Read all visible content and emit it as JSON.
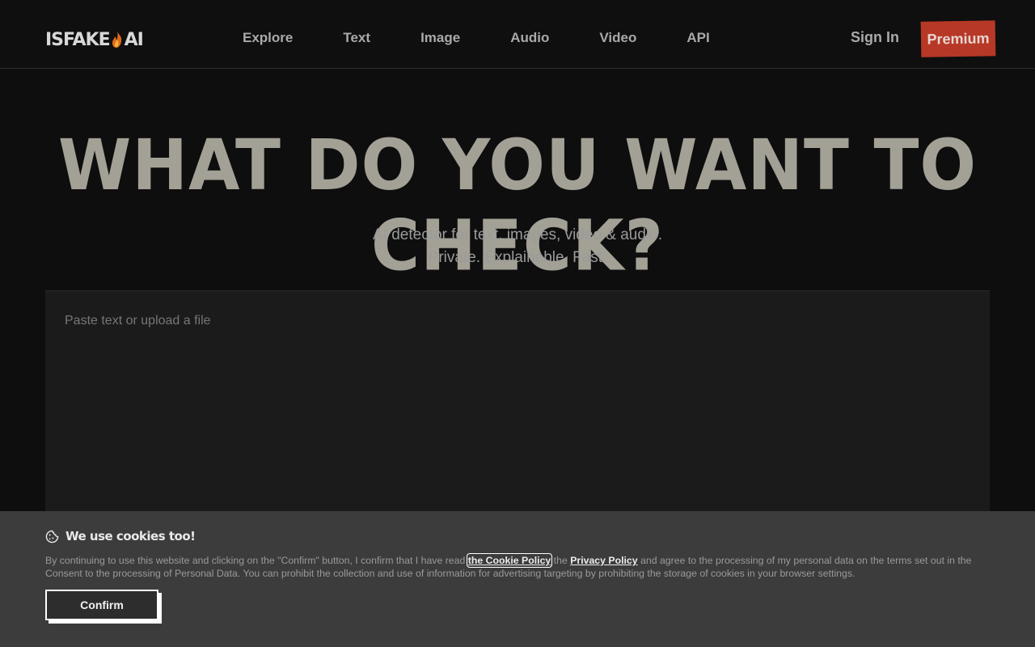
{
  "header": {
    "logo_left": "ISFAKE",
    "logo_right": "AI",
    "nav": [
      {
        "label": "Explore"
      },
      {
        "label": "Text"
      },
      {
        "label": "Image"
      },
      {
        "label": "Audio"
      },
      {
        "label": "Video"
      },
      {
        "label": "API"
      }
    ],
    "sign_in": "Sign In",
    "premium": "Premium"
  },
  "hero": {
    "title": "WHAT DO YOU WANT TO CHECK?",
    "subtitle_line1": "AI detector for text, images, video & audio.",
    "subtitle_line2": "Private. Explainable. Fast."
  },
  "input": {
    "placeholder": "Paste text or upload a file"
  },
  "cookie": {
    "title": "We use cookies too!",
    "text_before": "By continuing to use this website and clicking on the \"Confirm\" button, I confirm that I have read ",
    "cookie_policy": "the Cookie Policy",
    "text_mid": " the ",
    "privacy_policy": "Privacy Policy",
    "text_after": " and agree to the processing of my personal data on the terms set out in the Consent to the processing of Personal Data. You can prohibit the collection and use of information for advertising targeting by prohibiting the storage of cookies in your browser settings.",
    "confirm": "Confirm"
  },
  "colors": {
    "background": "#0e0e0e",
    "panel": "#1b1b1b",
    "banner": "#3c3c3c",
    "premium": "#b73826",
    "title": "#a3a095"
  },
  "icons": [
    "flame-icon",
    "cookie-icon"
  ]
}
